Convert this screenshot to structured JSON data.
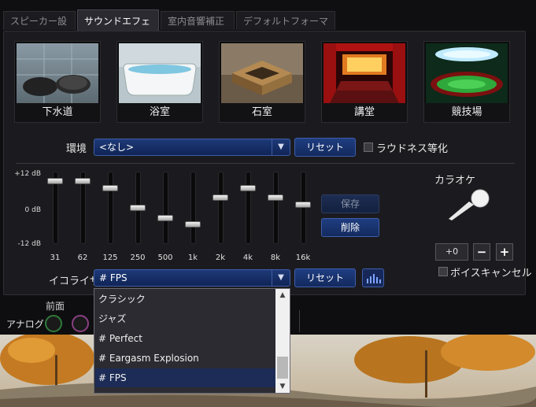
{
  "tabs": [
    {
      "label": "スピーカー設定",
      "active": false
    },
    {
      "label": "サウンドエフェクト",
      "active": true
    },
    {
      "label": "室内音響補正",
      "active": false
    },
    {
      "label": "デフォルトフォーマット",
      "active": false
    }
  ],
  "environments": [
    {
      "label": "下水道",
      "icon": "sewer-drain-icon"
    },
    {
      "label": "浴室",
      "icon": "bathtub-icon"
    },
    {
      "label": "石室",
      "icon": "stone-room-icon"
    },
    {
      "label": "講堂",
      "icon": "auditorium-icon"
    },
    {
      "label": "競技場",
      "icon": "stadium-icon"
    }
  ],
  "environment_row": {
    "label": "環境",
    "value": "<なし>",
    "reset_label": "リセット",
    "loudness_label": "ラウドネス等化"
  },
  "eq": {
    "db_top": "+12 dB",
    "db_mid": "0 dB",
    "db_bottom": "-12 dB",
    "bands": [
      {
        "freq": "31",
        "level": 0.9
      },
      {
        "freq": "62",
        "level": 0.9
      },
      {
        "freq": "125",
        "level": 0.8
      },
      {
        "freq": "250",
        "level": 0.5
      },
      {
        "freq": "500",
        "level": 0.35
      },
      {
        "freq": "1k",
        "level": 0.25
      },
      {
        "freq": "2k",
        "level": 0.65
      },
      {
        "freq": "4k",
        "level": 0.8
      },
      {
        "freq": "8k",
        "level": 0.65
      },
      {
        "freq": "16k",
        "level": 0.55
      }
    ],
    "save_label": "保存",
    "delete_label": "削除",
    "preset_label": "イコライザ",
    "preset_value": "# FPS",
    "reset_label": "リセット"
  },
  "karaoke": {
    "title": "カラオケ",
    "value": "+0",
    "minus": "−",
    "plus": "+",
    "voice_cancel_label": "ボイスキャンセル"
  },
  "dropdown": {
    "items": [
      {
        "label": "クラシック",
        "selected": false
      },
      {
        "label": "ジャズ",
        "selected": false
      },
      {
        "label": "# Perfect",
        "selected": false
      },
      {
        "label": "# Eargasm Explosion",
        "selected": false
      },
      {
        "label": "# FPS",
        "selected": true
      }
    ]
  },
  "analog": {
    "front_label": "前面",
    "analog_label": "アナログ"
  },
  "colors": {
    "accent": "#1e3a78",
    "jack_green": "#2f7a3a",
    "jack_pink": "#8a3f84"
  }
}
